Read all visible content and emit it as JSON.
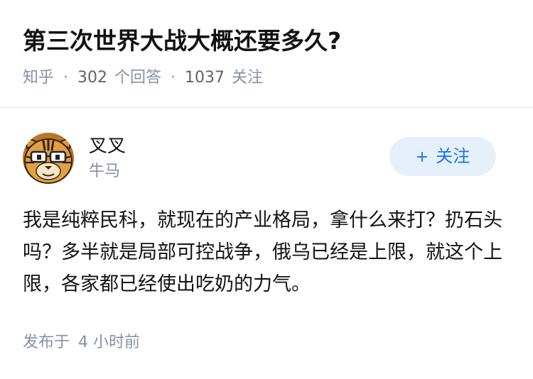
{
  "question": {
    "title": "第三次世界大战大概还要多久?",
    "source": "知乎",
    "separator": "·",
    "answer_count": "302",
    "answer_label": "个回答",
    "follower_count": "1037",
    "follower_label": "关注"
  },
  "author": {
    "name": "叉叉",
    "bio": "牛马",
    "avatar_icon": "cartoon-tiger-with-glasses-avatar"
  },
  "follow_button": {
    "icon": "+",
    "label": "关注"
  },
  "answer": {
    "text": "我是纯粹民科，就现在的产业格局，拿什么来打？扔石头吗？多半就是局部可控战争，俄乌已经是上限，就这个上限，各家都已经使出吃奶的力气。",
    "published_label": "发布于",
    "published_time": "4 小时前"
  },
  "colors": {
    "title": "#121212",
    "meta": "#8590a6",
    "accent": "#1772f6",
    "button_bg": "#e6f0fb",
    "divider": "#ebebeb"
  }
}
